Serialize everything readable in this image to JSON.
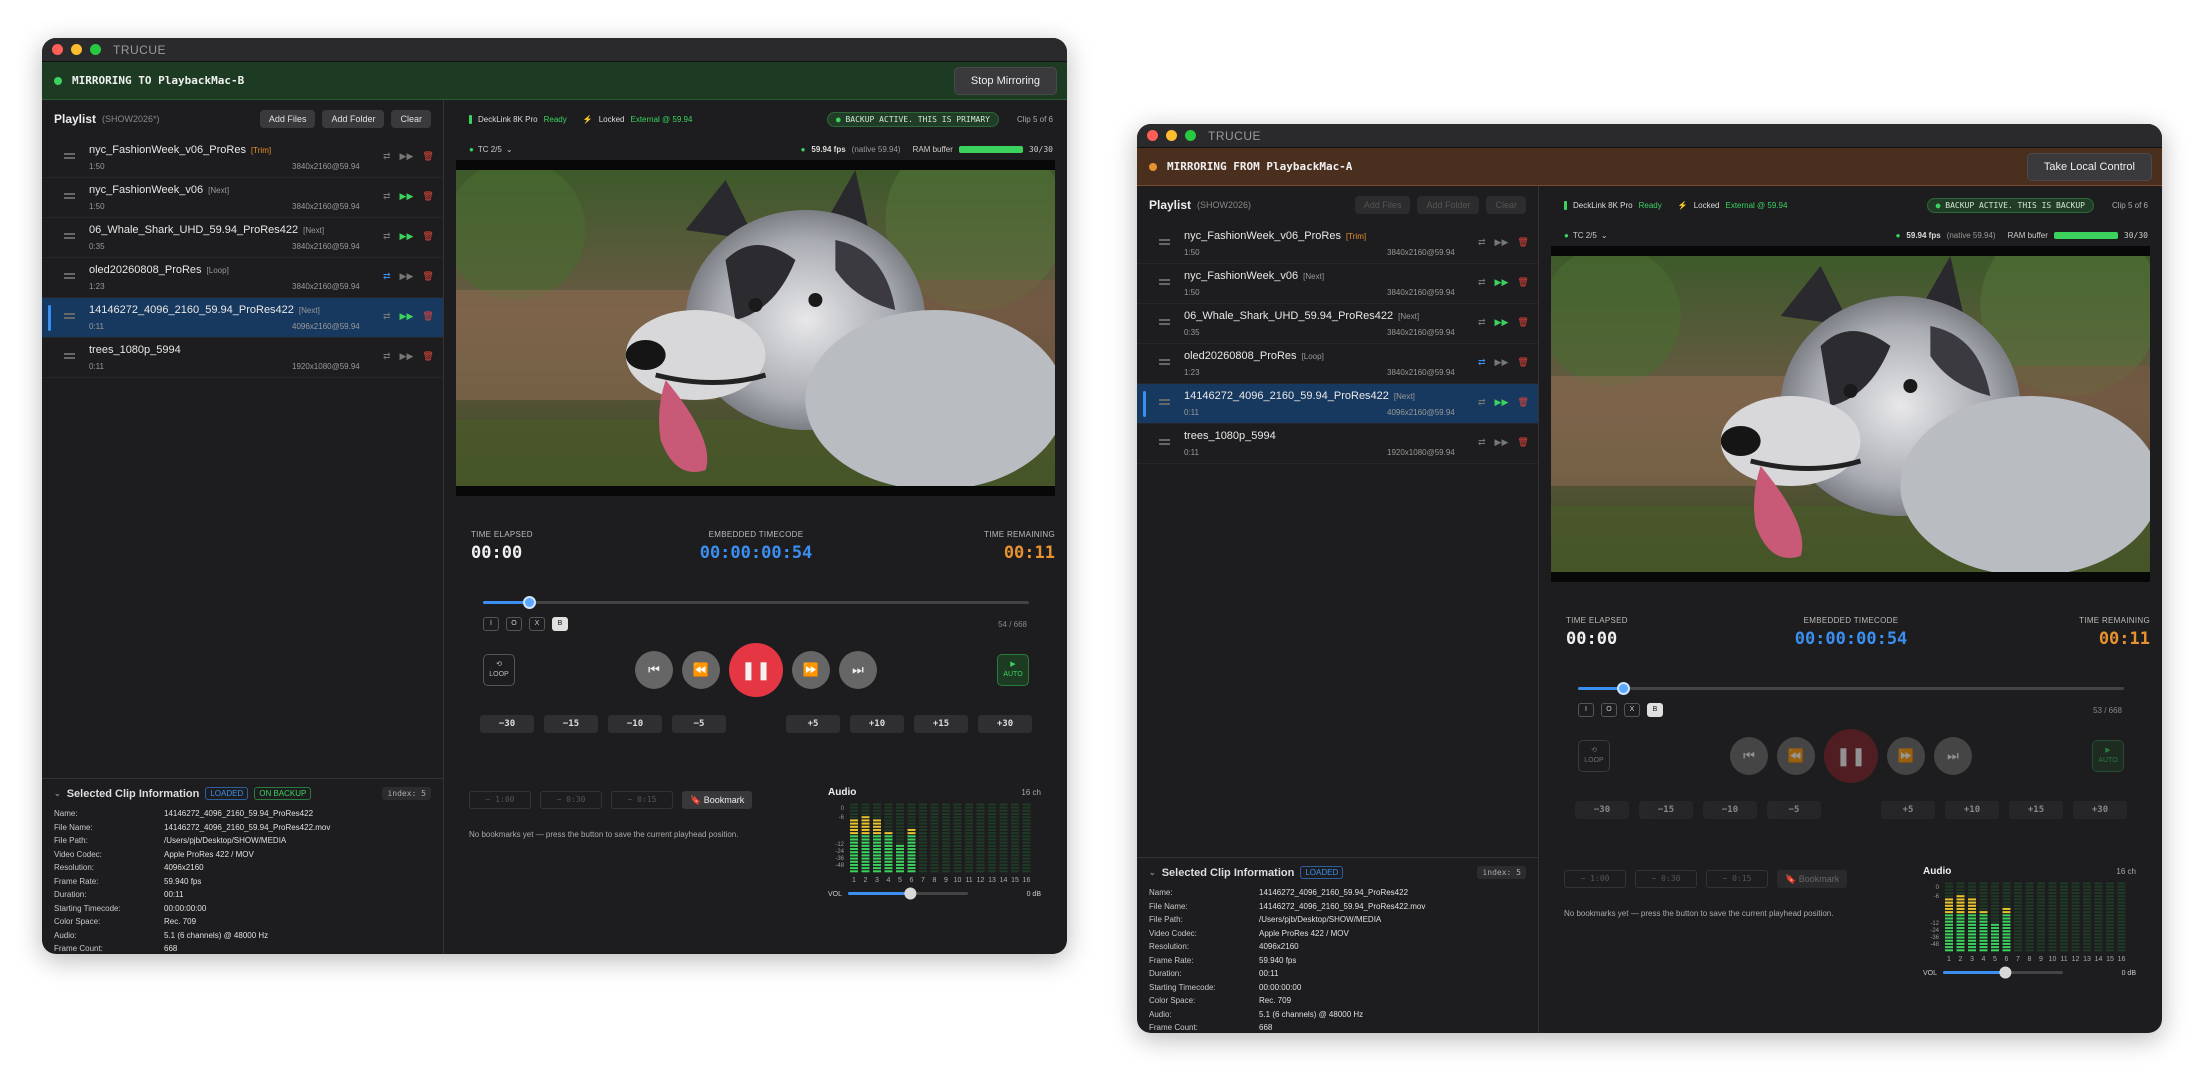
{
  "colors": {
    "green": "#3bd35e",
    "blue": "#3a8ff0",
    "orange": "#e8922e",
    "red": "#e53644"
  },
  "app_title": "TRUCUE",
  "playlist_header": {
    "title": "Playlist",
    "add_files": "Add Files",
    "add_folder": "Add Folder",
    "clear": "Clear"
  },
  "info_labels": [
    "Name:",
    "File Name:",
    "File Path:",
    "Video Codec:",
    "Resolution:",
    "Frame Rate:",
    "Duration:",
    "Starting Timecode:",
    "Color Space:",
    "Audio:",
    "Frame Count:"
  ],
  "info_values": [
    "14146272_4096_2160_59.94_ProRes422",
    "14146272_4096_2160_59.94_ProRes422.mov",
    "/Users/pjb/Desktop/SHOW/MEDIA",
    "Apple ProRes 422 / MOV",
    "4096x2160",
    "59.940 fps",
    "00:11",
    "00:00:00:00",
    "Rec. 709",
    "5.1 (6 channels) @ 48000 Hz",
    "668"
  ],
  "info_title": "Selected Clip Information",
  "badge_loaded": "LOADED",
  "badge_backup": "ON BACKUP",
  "index_label": "index: 5",
  "device": {
    "name": "DeckLink 8K Pro",
    "status": "Ready",
    "lock": "Locked",
    "ref": "External @ 59.94"
  },
  "tc_select": "TC 2/5",
  "fps": {
    "value": "59.94 fps",
    "native": "(native 59.94)",
    "ram_label": "RAM buffer",
    "ram_text": "30/30",
    "ram_fraction": 1.0
  },
  "timers": {
    "elapsed_label": "TIME ELAPSED",
    "elapsed": "00:00",
    "timecode_label": "EMBEDDED TIMECODE",
    "timecode": "00:00:00:54",
    "remaining_label": "TIME REMAINING",
    "remaining": "00:11"
  },
  "io": [
    "I",
    "O",
    "X",
    "B"
  ],
  "loop_label": "LOOP",
  "auto_label": "AUTO",
  "transport_icons": [
    "skip-back-icon",
    "rewind-icon",
    "pause-icon",
    "fast-forward-icon",
    "skip-forward-icon"
  ],
  "skips_left": [
    "−30",
    "−15",
    "−10",
    "−5"
  ],
  "skips_right": [
    "+5",
    "+10",
    "+15",
    "+30"
  ],
  "bookmarks": {
    "slots": [
      "− 1:00",
      "− 0:30",
      "− 0:15"
    ],
    "button": "Bookmark",
    "note": "No bookmarks yet — press the button to save the current playhead position."
  },
  "audio": {
    "title": "Audio",
    "channels": "16 ch",
    "scale": [
      "0",
      "-6",
      "-12",
      "-24",
      "-36",
      "-48"
    ],
    "vol_label": "VOL",
    "vol_db": "0 dB",
    "vol_level": 0.52,
    "levels": [
      0.78,
      0.86,
      0.78,
      0.6,
      0.44,
      0.68,
      0,
      0,
      0,
      0,
      0,
      0,
      0,
      0,
      0,
      0
    ],
    "channel_numbers": [
      "1",
      "2",
      "3",
      "4",
      "5",
      "6",
      "7",
      "8",
      "9",
      "10",
      "11",
      "12",
      "13",
      "14",
      "15",
      "16"
    ]
  },
  "windows": [
    {
      "banner": "MIRRORING TO PlaybackMac-B",
      "banner_button": "Stop Mirroring",
      "show": "(SHOW2026*)",
      "backup_text": "BACKUP ACTIVE. THIS IS PRIMARY",
      "clip_of": "Clip 5 of 6",
      "frame_count": "54 / 668",
      "scrub_fraction": 0.085
    },
    {
      "banner": "MIRRORING FROM PlaybackMac-A",
      "banner_button": "Take Local Control",
      "show": "(SHOW2026)",
      "backup_text": "BACKUP ACTIVE. THIS IS BACKUP",
      "clip_of": "Clip 5 of 6",
      "frame_count": "53 / 668",
      "scrub_fraction": 0.083
    }
  ],
  "clips": [
    {
      "name": "nyc_FashionWeek_v06_ProRes",
      "tag": "[Trim]",
      "duration": "1:50",
      "res": "3840x2160@59.94"
    },
    {
      "name": "nyc_FashionWeek_v06",
      "tag": "[Next]",
      "duration": "1:50",
      "res": "3840x2160@59.94"
    },
    {
      "name": "06_Whale_Shark_UHD_59.94_ProRes422",
      "tag": "[Next]",
      "duration": "0:35",
      "res": "3840x2160@59.94"
    },
    {
      "name": "oled20260808_ProRes",
      "tag": "[Loop]",
      "duration": "1:23",
      "res": "3840x2160@59.94"
    },
    {
      "name": "14146272_4096_2160_59.94_ProRes422",
      "tag": "[Next]",
      "duration": "0:11",
      "res": "4096x2160@59.94"
    },
    {
      "name": "trees_1080p_5994",
      "tag": "",
      "duration": "0:11",
      "res": "1920x1080@59.94"
    }
  ]
}
